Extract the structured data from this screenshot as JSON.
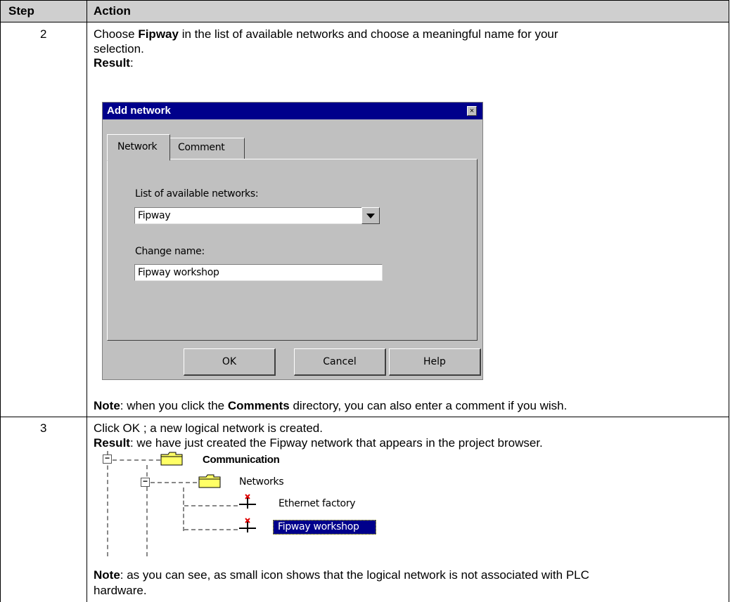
{
  "table": {
    "header": {
      "step": "Step",
      "action": "Action"
    },
    "rows": [
      {
        "step": "2",
        "line1_pre": "Choose ",
        "line1_bold": "Fipway",
        "line1_post": " in the list of available networks and choose a meaningful name for your",
        "line2": "selection.",
        "result_label": "Result",
        "result_colon": ":",
        "note_label": "Note",
        "note_pre": ": when you click the ",
        "note_bold": "Comments",
        "note_post": " directory, you can also enter a comment if you wish."
      },
      {
        "step": "3",
        "line1": "Click OK ; a new logical network is created.",
        "result_label": "Result",
        "result_text": ": we have just created the Fipway network that appears in the project browser.",
        "note_label": "Note",
        "note_text1": ": as you can see, as small icon shows that the logical network is not associated with PLC",
        "note_text2": "hardware."
      }
    ]
  },
  "dialog": {
    "title": "Add network",
    "close_glyph": "×",
    "tabs": [
      "Network",
      "Comment"
    ],
    "list_label": "List of available networks:",
    "list_value": "Fipway",
    "name_label": "Change name:",
    "name_value": "Fipway workshop",
    "buttons": {
      "ok": "OK",
      "cancel": "Cancel",
      "help": "Help"
    }
  },
  "tree": {
    "root": "Communication",
    "child": "Networks",
    "items": [
      "Ethernet factory",
      "Fipway workshop"
    ],
    "selected_color": "#00008b",
    "folder_color": "#ffff66"
  }
}
